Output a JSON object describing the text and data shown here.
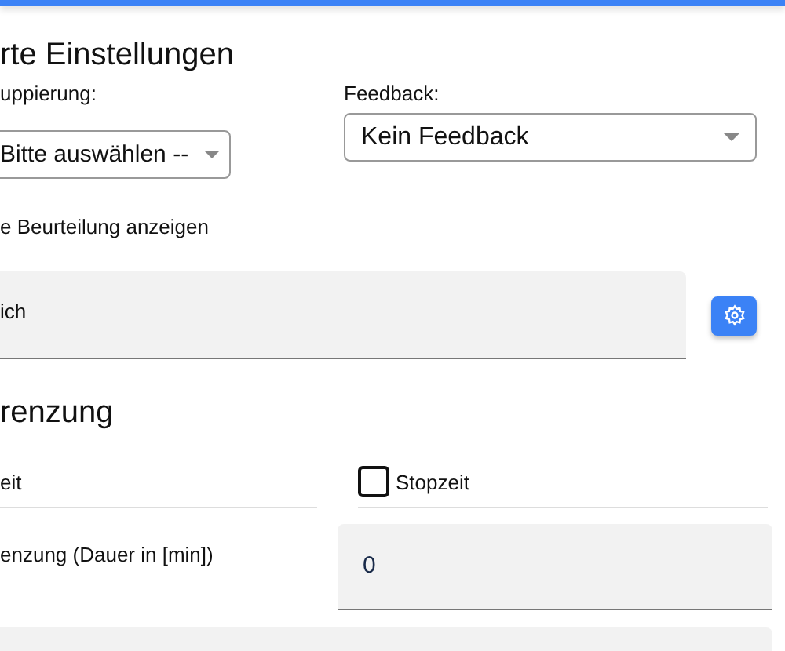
{
  "section_title": "rte Einstellungen",
  "grouping": {
    "label": "uppierung:",
    "value": "Bitte auswählen --"
  },
  "feedback": {
    "label": "Feedback:",
    "value": "Kein Feedback"
  },
  "assessment_label": "e Beurteilung anzeigen",
  "assessment_field": {
    "value": "ich"
  },
  "limit_title": "renzung",
  "start_time": {
    "label": "eit"
  },
  "stop_time": {
    "label": "Stopzeit",
    "checked": false
  },
  "duration": {
    "label": "enzung (Dauer in [min])",
    "value": "0"
  }
}
